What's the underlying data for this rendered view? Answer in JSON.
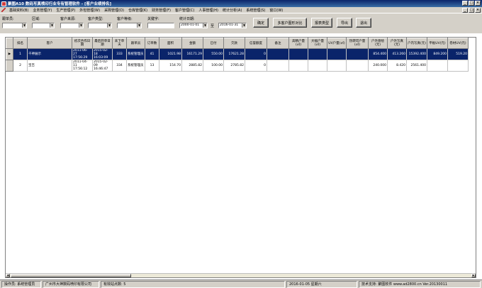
{
  "window": {
    "title": "聚图A10 数码写真喷印行业专有管理软件 - [客户业绩排名]",
    "min": "_",
    "max": "□",
    "close": "×"
  },
  "menubar": {
    "items": [
      "基础资料(B)",
      "业务管理(Y)",
      "生产管理(P)",
      "外包管理(W)",
      "采购管理(O)",
      "仓库管理(K)",
      "财务管理(F)",
      "客户管理(C)",
      "人事管理(H)",
      "统计分析(A)",
      "系统管理(S)",
      "窗口(W)"
    ],
    "right_min": "_",
    "right_max": "□",
    "right_close": "×"
  },
  "filters": {
    "labels": {
      "order_person": "跟单员:",
      "region": "区域:",
      "customer_source": "客户来源:",
      "customer_type": "客户类型:",
      "customer_level": "客户等级:",
      "keyword": "关键字:",
      "stat_date": "统计日期:"
    },
    "values": {
      "order_person": "",
      "region": "",
      "customer_source": "",
      "customer_type": "",
      "customer_level": "",
      "keyword": "",
      "date_from": "2000-01-01",
      "date_to": "2016-01-31"
    },
    "tilde": "至",
    "arrow": "▼"
  },
  "buttons": {
    "confirm": "确定",
    "multi_chart": "多客户图形对比",
    "report_type": "报表类型",
    "export": "导出",
    "exit": "退出"
  },
  "grid": {
    "columns": [
      "排名",
      "客户",
      "初次合作日期",
      "最后开单日期",
      "未下单天",
      "跟单员",
      "订单数",
      "面积",
      "金额",
      "已付",
      "欠款",
      "信誉额度",
      "备注",
      "高精户量(㎡)",
      "大幅户量(㎡)",
      "UV户量(㎡)",
      "热转印户量(㎡)",
      "户外喷绘(元)",
      "户外写真(元)",
      "户内写真(元)",
      "平板UV(元)",
      "卷材UV(元)"
    ],
    "rows": [
      {
        "selected": true,
        "marker": "▶",
        "cells": [
          "1",
          "千神展示",
          "2011-06-27 17:56:29",
          "2015-02-18 16:03:09",
          "333",
          "系统管理员",
          "41",
          "1021.98",
          "16171.29",
          "550.00",
          "17621.28",
          "0",
          "",
          "",
          "",
          "",
          "",
          "854.400",
          "413.260",
          "15392.400",
          "849.200",
          "519.20"
        ]
      },
      {
        "selected": false,
        "marker": "",
        "cells": [
          "2",
          "宝吉",
          "2011-04-11 17:56:12",
          "2015-02-09 16:46:47",
          "334",
          "系统管理员",
          "13",
          "154.70",
          "2885.82",
          "100.00",
          "2785.82",
          "0",
          "",
          "",
          "",
          "",
          "",
          "240.000",
          "8.420",
          "2561.400",
          "",
          ""
        ]
      }
    ]
  },
  "scrollbar": {
    "left": "◀",
    "right": "▶"
  },
  "status": {
    "operator": "操作员: 系统管理员",
    "company": "广州市大神数码喷印有限公司",
    "sites": "有效站点数: 5",
    "date": "2016-01-05 星期六",
    "support": "技术支持: 聚图软件 www.ad2800.cn Ver.20130011"
  }
}
